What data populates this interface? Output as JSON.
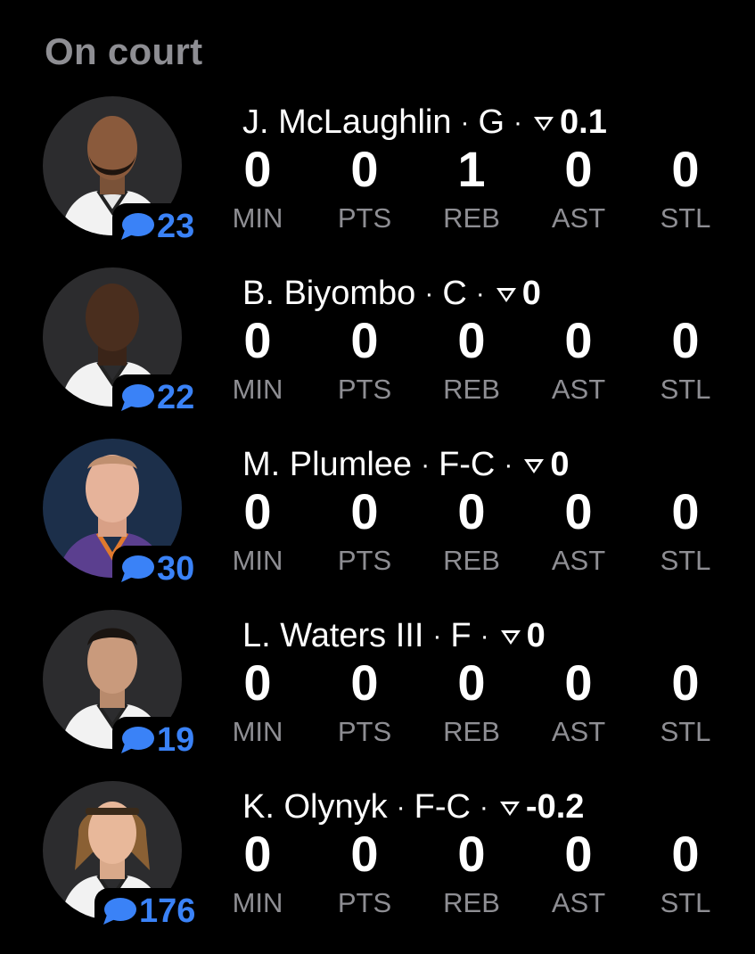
{
  "section_title": "On court",
  "colors": {
    "background": "#000000",
    "accent_blue": "#3a82f7",
    "muted_gray": "#8e8e93"
  },
  "players": [
    {
      "name": "J. McLaughlin",
      "position": "G",
      "rating": "0.1",
      "comments": "23",
      "stats": [
        {
          "label": "MIN",
          "value": "0"
        },
        {
          "label": "PTS",
          "value": "0"
        },
        {
          "label": "REB",
          "value": "1"
        },
        {
          "label": "AST",
          "value": "0"
        },
        {
          "label": "STL",
          "value": "0"
        }
      ]
    },
    {
      "name": "B. Biyombo",
      "position": "C",
      "rating": "0",
      "comments": "22",
      "stats": [
        {
          "label": "MIN",
          "value": "0"
        },
        {
          "label": "PTS",
          "value": "0"
        },
        {
          "label": "REB",
          "value": "0"
        },
        {
          "label": "AST",
          "value": "0"
        },
        {
          "label": "STL",
          "value": "0"
        }
      ]
    },
    {
      "name": "M. Plumlee",
      "position": "F-C",
      "rating": "0",
      "comments": "30",
      "stats": [
        {
          "label": "MIN",
          "value": "0"
        },
        {
          "label": "PTS",
          "value": "0"
        },
        {
          "label": "REB",
          "value": "0"
        },
        {
          "label": "AST",
          "value": "0"
        },
        {
          "label": "STL",
          "value": "0"
        }
      ]
    },
    {
      "name": "L. Waters III",
      "position": "F",
      "rating": "0",
      "comments": "19",
      "stats": [
        {
          "label": "MIN",
          "value": "0"
        },
        {
          "label": "PTS",
          "value": "0"
        },
        {
          "label": "REB",
          "value": "0"
        },
        {
          "label": "AST",
          "value": "0"
        },
        {
          "label": "STL",
          "value": "0"
        }
      ]
    },
    {
      "name": "K. Olynyk",
      "position": "F-C",
      "rating": "-0.2",
      "comments": "176",
      "stats": [
        {
          "label": "MIN",
          "value": "0"
        },
        {
          "label": "PTS",
          "value": "0"
        },
        {
          "label": "REB",
          "value": "0"
        },
        {
          "label": "AST",
          "value": "0"
        },
        {
          "label": "STL",
          "value": "0"
        }
      ]
    }
  ],
  "icons": {
    "avatar": "player-headshot-icon",
    "comment": "speech-bubble-icon",
    "rating": "rating-chevron-icon"
  }
}
